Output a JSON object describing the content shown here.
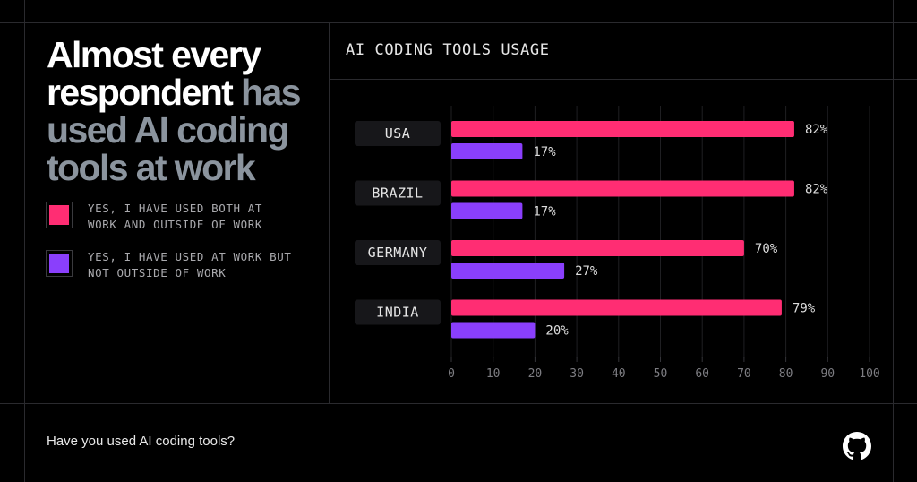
{
  "headline": {
    "part1": "Almost every",
    "part2": "respondent",
    "part3": "has",
    "part4": "used AI coding",
    "part5": "tools at work"
  },
  "legend": [
    {
      "label": "YES, I HAVE USED BOTH AT WORK AND OUTSIDE OF WORK",
      "color": "#ff2d73"
    },
    {
      "label": "YES, I HAVE USED AT WORK BUT NOT OUTSIDE OF WORK",
      "color": "#8a3ffc"
    }
  ],
  "footer": {
    "question": "Have you used AI coding tools?",
    "logo": "github-icon"
  },
  "chart_data": {
    "type": "bar",
    "orientation": "horizontal",
    "title": "AI CODING TOOLS USAGE",
    "categories": [
      "USA",
      "BRAZIL",
      "GERMANY",
      "INDIA"
    ],
    "series": [
      {
        "name": "YES, I HAVE USED BOTH AT WORK AND OUTSIDE OF WORK",
        "color": "#ff2d73",
        "values": [
          82,
          82,
          70,
          79
        ],
        "labels": [
          "82%",
          "82%",
          "70%",
          "79%"
        ]
      },
      {
        "name": "YES, I HAVE USED AT WORK BUT NOT OUTSIDE OF WORK",
        "color": "#8a3ffc",
        "values": [
          17,
          17,
          27,
          20
        ],
        "labels": [
          "17%",
          "17%",
          "27%",
          "20%"
        ]
      }
    ],
    "xlabel": "",
    "ylabel": "",
    "xlim": [
      0,
      100
    ],
    "xticks": [
      0,
      10,
      20,
      30,
      40,
      50,
      60,
      70,
      80,
      90,
      100
    ],
    "grid": true,
    "legend_position": "left"
  }
}
